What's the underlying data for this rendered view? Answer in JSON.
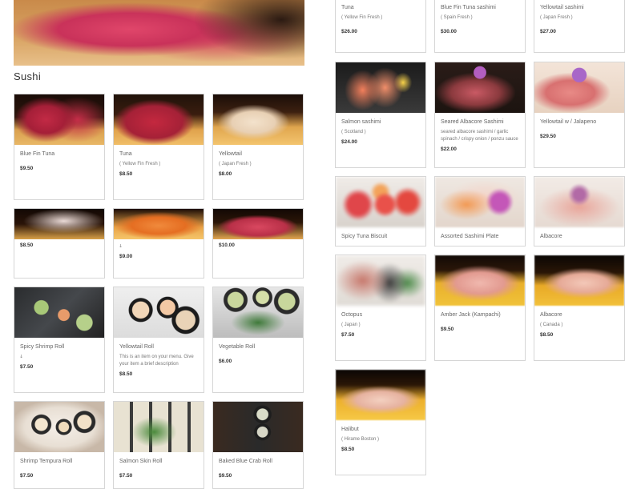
{
  "section_title": "Sushi",
  "left_items": [
    {
      "name": "Blue Fin Tuna",
      "sub": "",
      "price": "$9.50"
    },
    {
      "name": "Tuna",
      "sub": "( Yellow Fin Fresh )",
      "price": "$8.50"
    },
    {
      "name": "Yellowtail",
      "sub": "( Japan Fresh )",
      "price": "$8.00"
    },
    {
      "name": "",
      "sub": "",
      "price": "$8.50"
    },
    {
      "name": "",
      "sub": "ↆ",
      "price": "$9.00"
    },
    {
      "name": "",
      "sub": "",
      "price": "$10.00"
    },
    {
      "name": "Spicy Shrimp Roll",
      "sub": "ↆ",
      "price": "$7.50"
    },
    {
      "name": "Yellowtail Roll",
      "sub": "This is an item on your menu. Give your item a brief description",
      "price": "$8.50"
    },
    {
      "name": "Vegetable Roll",
      "sub": "",
      "price": "$6.00"
    },
    {
      "name": "Shrimp Tempura Roll",
      "sub": "",
      "price": "$7.50"
    },
    {
      "name": "Salmon Skin Roll",
      "sub": "",
      "price": "$7.50"
    },
    {
      "name": "Baked Blue Crab Roll",
      "sub": "",
      "price": "$9.50"
    }
  ],
  "right_items": [
    {
      "name": "Tuna",
      "sub": "( Yellow Fin Fresh )",
      "price": "$26.00"
    },
    {
      "name": "Blue Fin Tuna sashimi",
      "sub": "( Spain Fresh )",
      "price": "$30.00"
    },
    {
      "name": "Yellowtail sashimi",
      "sub": "( Japan Fresh )",
      "price": "$27.00"
    },
    {
      "name": "Salmon sashimi",
      "sub": "( Scotland )",
      "price": "$24.00"
    },
    {
      "name": "Seared Albacore Sashimi",
      "sub": "seared albacore sashimi / garlic spinach / crispy onion / ponzu sauce",
      "price": "$22.00"
    },
    {
      "name": "Yellowtail w / Jalapeno",
      "sub": "",
      "price": "$29.50"
    },
    {
      "name": "Spicy Tuna Biscuit",
      "sub": "",
      "price": ""
    },
    {
      "name": "Assorted Sashimi Plate",
      "sub": "",
      "price": ""
    },
    {
      "name": "Albacore",
      "sub": "",
      "price": ""
    },
    {
      "name": "Octopus",
      "sub": "( Japan )",
      "price": "$7.50"
    },
    {
      "name": "Amber Jack (Kampachi)",
      "sub": "",
      "price": "$9.50"
    },
    {
      "name": "Albacore",
      "sub": "( Canada )",
      "price": "$8.50"
    },
    {
      "name": "Halibut",
      "sub": "( Hirame Boston )",
      "price": "$8.50"
    }
  ]
}
